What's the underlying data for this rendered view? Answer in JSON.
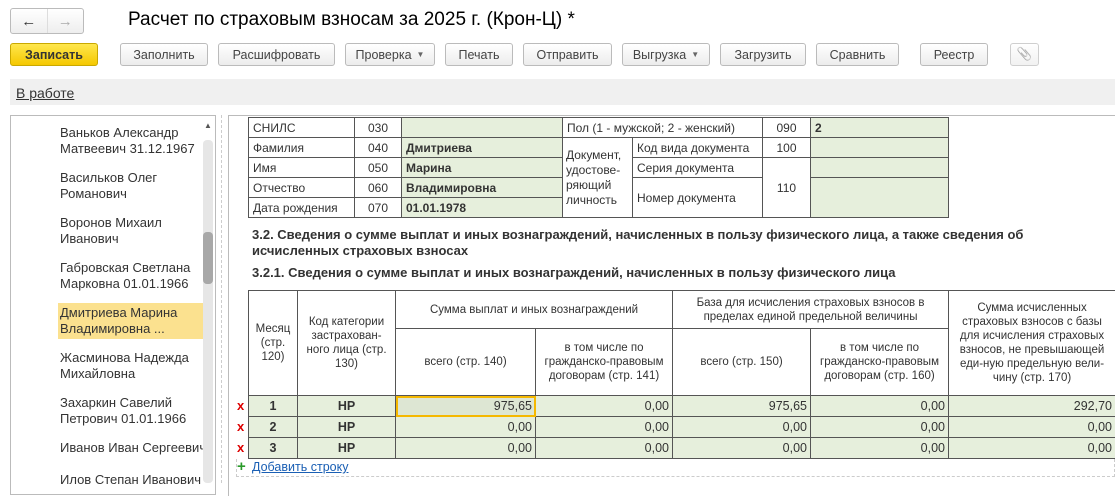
{
  "window": {
    "title": "Расчет по страховым взносам за 2025 г. (Крон-Ц) *",
    "back": "←",
    "forward": "→"
  },
  "toolbar": {
    "save": "Записать",
    "fill": "Заполнить",
    "decode": "Расшифровать",
    "check": "Проверка",
    "print": "Печать",
    "send": "Отправить",
    "export": "Выгрузка",
    "import": "Загрузить",
    "compare": "Сравнить",
    "registry": "Реестр",
    "attach_icon": "paperclip-icon",
    "dropdown_caret": "▼",
    "attach_glyph": "📎"
  },
  "status": {
    "link": "В работе"
  },
  "employees": [
    {
      "line1": "Ваньков Александр",
      "line2": "Матвеевич 31.12.1967"
    },
    {
      "line1": "Васильков Олег",
      "line2": "Романович"
    },
    {
      "line1": "Воронов Михаил",
      "line2": "Иванович"
    },
    {
      "line1": "Габровская Светлана",
      "line2": "Марковна 01.01.1966"
    },
    {
      "line1": "Дмитриева Марина",
      "line2": "Владимировна ...",
      "selected": true
    },
    {
      "line1": "Жасминова Надежда",
      "line2": "Михайловна"
    },
    {
      "line1": "Захаркин Савелий",
      "line2": "Петрович 01.01.1966"
    },
    {
      "line1": "Иванов Иван Сергеевич",
      "line2": ""
    },
    {
      "line1": "Илов Степан Иванович",
      "line2": ""
    }
  ],
  "person": {
    "snils": {
      "label": "СНИЛС",
      "code": "030",
      "value": ""
    },
    "surname": {
      "label": "Фамилия",
      "code": "040",
      "value": "Дмитриева"
    },
    "name": {
      "label": "Имя",
      "code": "050",
      "value": "Марина"
    },
    "patronymic": {
      "label": "Отчество",
      "code": "060",
      "value": "Владимировна"
    },
    "birthdate": {
      "label": "Дата рождения",
      "code": "070",
      "value": "01.01.1978"
    },
    "gender": {
      "label": "Пол (1 - мужской; 2 - женский)",
      "code": "090",
      "value": "2"
    },
    "doc_label": "Документ, удостове-ряющий личность",
    "doc_type": {
      "label": "Код вида документа",
      "code": "100",
      "value": ""
    },
    "doc_series": {
      "label": "Серия документа",
      "value": ""
    },
    "doc_number": {
      "label": "Номер документа",
      "value": ""
    },
    "doc_series_number_code": "110"
  },
  "section": {
    "h32": "3.2. Сведения о сумме выплат и иных вознаграждений, начисленных в пользу физического лица, а также сведения об исчисленных страховых взносах",
    "h321": "3.2.1. Сведения о сумме выплат и иных вознаграждений, начисленных в пользу физического лица"
  },
  "payments": {
    "headers": {
      "month": "Месяц (стр. 120)",
      "category": "Код категории застрахован-ного лица (стр. 130)",
      "sum_group": "Сумма выплат и иных вознаграждений",
      "sum_total": "всего (стр. 140)",
      "sum_gpd": "в том числе по гражданско-правовым договорам (стр. 141)",
      "base_group": "База для исчисления страховых взносов в пределах единой предельной величины",
      "base_total": "всего (стр. 150)",
      "base_gpd": "в том числе по гражданско-правовым договорам (стр. 160)",
      "contrib": "Сумма исчисленных страховых взносов с базы для исчисления страховых взносов, не превышающей еди-ную предельную вели-чину (стр. 170)"
    },
    "rows": [
      {
        "delete": "x",
        "month": "1",
        "category": "НР",
        "sum_total": "975,65",
        "sum_gpd": "0,00",
        "base_total": "975,65",
        "base_gpd": "0,00",
        "contrib": "292,70"
      },
      {
        "delete": "x",
        "month": "2",
        "category": "НР",
        "sum_total": "0,00",
        "sum_gpd": "0,00",
        "base_total": "0,00",
        "base_gpd": "0,00",
        "contrib": "0,00"
      },
      {
        "delete": "x",
        "month": "3",
        "category": "НР",
        "sum_total": "0,00",
        "sum_gpd": "0,00",
        "base_total": "0,00",
        "base_gpd": "0,00",
        "contrib": "0,00"
      }
    ],
    "add_row": "Добавить строку",
    "add_glyph": "+"
  }
}
